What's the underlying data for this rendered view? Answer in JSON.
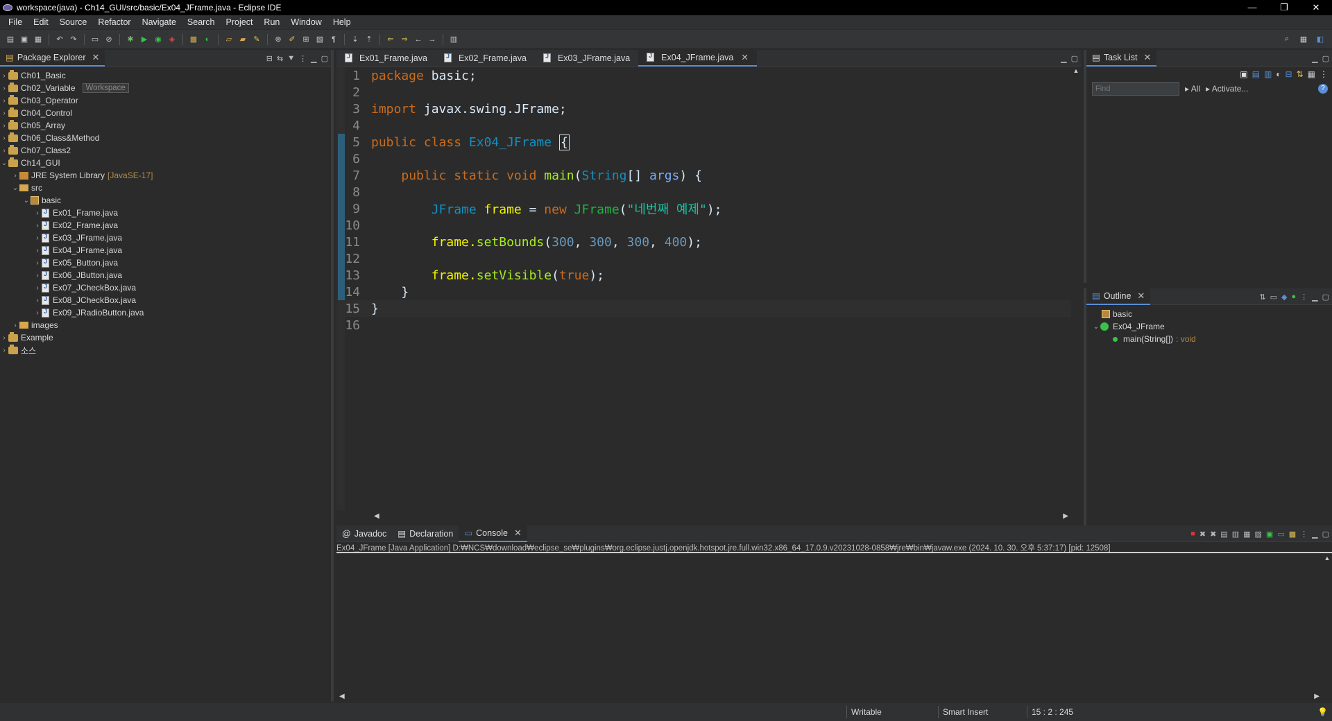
{
  "window": {
    "title": "workspace(java) - Ch14_GUI/src/basic/Ex04_JFrame.java - Eclipse IDE",
    "controls": [
      "—",
      "❐",
      "✕"
    ]
  },
  "menu": [
    "File",
    "Edit",
    "Source",
    "Refactor",
    "Navigate",
    "Search",
    "Project",
    "Run",
    "Window",
    "Help"
  ],
  "package_explorer": {
    "tab_label": "Package Explorer",
    "tooltip": "Workspace",
    "items": [
      {
        "label": "Ch01_Basic"
      },
      {
        "label": "Ch02_Variable"
      },
      {
        "label": "Ch03_Operator"
      },
      {
        "label": "Ch04_Control"
      },
      {
        "label": "Ch05_Array"
      },
      {
        "label": "Ch06_Class&Method"
      },
      {
        "label": "Ch07_Class2"
      },
      {
        "label": "Ch14_GUI"
      },
      {
        "label": "JRE System Library",
        "suffix": "[JavaSE-17]"
      },
      {
        "label": "src"
      },
      {
        "label": "basic"
      },
      {
        "label": "Ex01_Frame.java"
      },
      {
        "label": "Ex02_Frame.java"
      },
      {
        "label": "Ex03_JFrame.java"
      },
      {
        "label": "Ex04_JFrame.java"
      },
      {
        "label": "Ex05_Button.java"
      },
      {
        "label": "Ex06_JButton.java"
      },
      {
        "label": "Ex07_JCheckBox.java"
      },
      {
        "label": "Ex08_JCheckBox.java"
      },
      {
        "label": "Ex09_JRadioButton.java"
      },
      {
        "label": "images"
      },
      {
        "label": "Example"
      },
      {
        "label": "소스"
      }
    ]
  },
  "editor": {
    "tabs": [
      {
        "label": "Ex01_Frame.java"
      },
      {
        "label": "Ex02_Frame.java"
      },
      {
        "label": "Ex03_JFrame.java"
      },
      {
        "label": "Ex04_JFrame.java"
      }
    ],
    "line_numbers": [
      "1",
      "2",
      "3",
      "4",
      "5",
      "6",
      "7",
      "8",
      "9",
      "10",
      "11",
      "12",
      "13",
      "14",
      "15",
      "16"
    ],
    "code": {
      "l1_kw": "package",
      "l1_rest": " basic;",
      "l3_kw": "import",
      "l3_rest": " javax.swing.JFrame;",
      "l5_kw": "public class",
      "l5_cls": "Ex04_JFrame",
      "l5_brace": "{",
      "l7_kw": "public static void",
      "l7_meth": "main",
      "l7_type": "String",
      "l7_arr": "[]",
      "l7_param": "args",
      "l7_end": ") {",
      "l9_cls": "JFrame",
      "l9_var": "frame",
      "l9_eq": " = ",
      "l9_new": "new",
      "l9_cls2": "JFrame",
      "l9_str": "\"네번째 예제\"",
      "l9_end": ");",
      "l11_obj": "frame.",
      "l11_meth": "setBounds",
      "l11_n1": "300",
      "l11_n2": "300",
      "l11_n3": "300",
      "l11_n4": "400",
      "l11_end": ");",
      "l13_obj": "frame.",
      "l13_meth": "setVisible",
      "l13_kw": "true",
      "l13_end": ");",
      "l14": "}",
      "l15": "}"
    }
  },
  "task_list": {
    "tab_label": "Task List",
    "find_placeholder": "Find",
    "all_label": "All",
    "activate_label": "Activate..."
  },
  "outline": {
    "tab_label": "Outline",
    "package": "basic",
    "class": "Ex04_JFrame",
    "method": "main(String[])",
    "method_type": ": void"
  },
  "console": {
    "tabs": [
      {
        "label": "Javadoc"
      },
      {
        "label": "Declaration"
      },
      {
        "label": "Console"
      }
    ],
    "info": "Ex04_JFrame [Java Application] D:₩NCS₩download₩eclipse_se₩plugins₩org.eclipse.justj.openjdk.hotspot.jre.full.win32.x86_64_17.0.9.v20231028-0858₩jre₩bin₩javaw.exe  (2024. 10. 30. 오후 5:37:17) [pid: 12508]"
  },
  "status": {
    "writable": "Writable",
    "insert_mode": "Smart Insert",
    "position": "15 : 2 : 245"
  }
}
